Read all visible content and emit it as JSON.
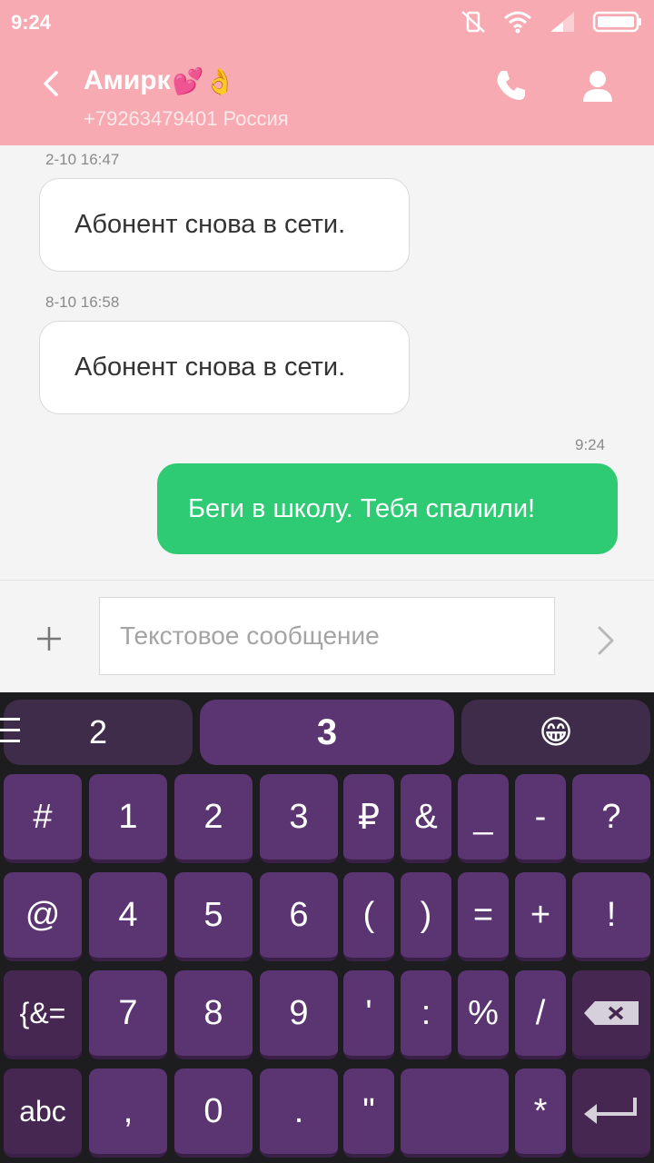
{
  "status": {
    "time": "9:24"
  },
  "header": {
    "name": "Амирк",
    "name_emoji": "💕👌",
    "subtitle": "+79263479401 Россия"
  },
  "messages": [
    {
      "timestamp": "2-10 16:47",
      "text": "Абонент снова в сети.",
      "direction": "in"
    },
    {
      "timestamp": "8-10 16:58",
      "text": "Абонент снова в сети.",
      "direction": "in"
    },
    {
      "timestamp": "9:24",
      "text": "Беги в школу.  Тебя спалили!",
      "direction": "out"
    }
  ],
  "composer": {
    "placeholder": "Текстовое сообщение"
  },
  "keyboard": {
    "suggestions": [
      "2",
      "3",
      "😁"
    ],
    "rows": [
      [
        "#",
        "1",
        "2",
        "3",
        "₽",
        "&",
        "_",
        "-",
        "?"
      ],
      [
        "@",
        "4",
        "5",
        "6",
        "(",
        ")",
        "=",
        "+",
        "!"
      ],
      [
        "{&=",
        "7",
        "8",
        "9",
        "'",
        ":",
        "%",
        "/"
      ],
      [
        "abc",
        ",",
        "0",
        ".",
        "\"",
        "*"
      ]
    ]
  },
  "colors": {
    "header": "#f7aab1",
    "outgoing_bubble": "#2ecb74",
    "key": "#5b3472",
    "keyboard_bg": "#1d1c1f"
  }
}
